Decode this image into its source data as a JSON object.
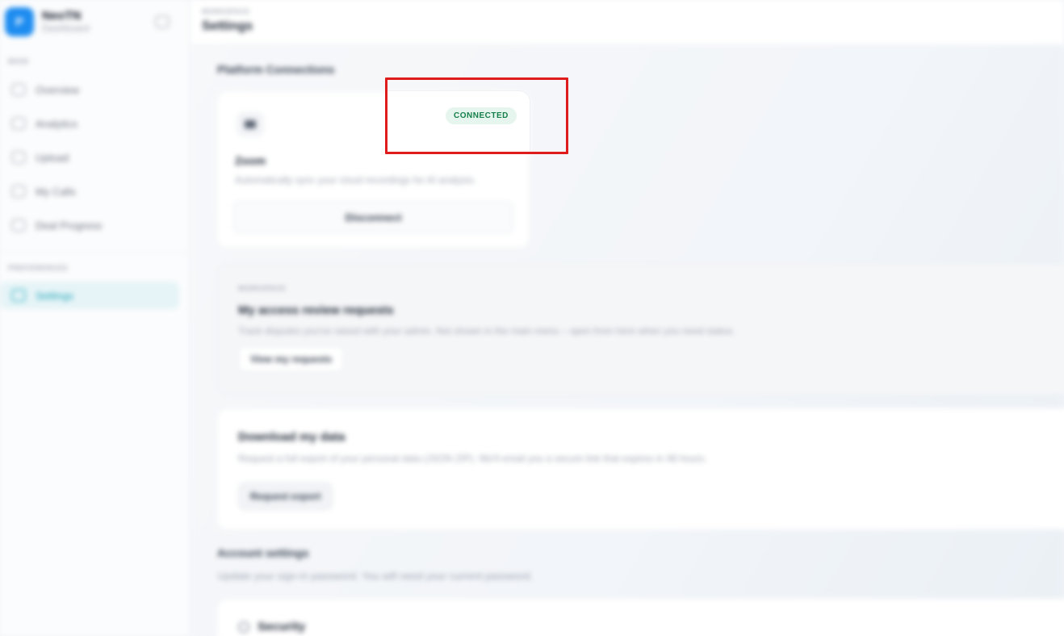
{
  "sidebar": {
    "brand_name": "NeoTN",
    "brand_sub": "Dashboard",
    "brand_initial": "P",
    "section_main": "MAIN",
    "section_prefs": "PREFERENCES",
    "items": [
      {
        "label": "Overview",
        "icon": "grid-icon"
      },
      {
        "label": "Analytics",
        "icon": "chart-icon"
      },
      {
        "label": "Upload",
        "icon": "upload-icon"
      },
      {
        "label": "My Calls",
        "icon": "phone-icon"
      },
      {
        "label": "Deal Progress",
        "icon": "trend-icon"
      },
      {
        "label": "Settings",
        "icon": "gear-icon",
        "active": true
      }
    ]
  },
  "header": {
    "eyebrow": "WORKSPACE",
    "title": "Settings"
  },
  "platform": {
    "title": "Platform Connections",
    "zoom": {
      "name": "Zoom",
      "description": "Automatically sync your cloud recordings for AI analysis.",
      "status": "CONNECTED",
      "button": "Disconnect"
    }
  },
  "access": {
    "eyebrow": "WORKSPACE",
    "title": "My access review requests",
    "description": "Track disputes you've raised with your admin. Not shown in the main menu – open from here when you need status.",
    "button": "View my requests"
  },
  "download": {
    "title": "Download my data",
    "description": "Request a full export of your personal data (JSON ZIP). We'll email you a secure link that expires in 48 hours.",
    "button": "Request export"
  },
  "account": {
    "title": "Account settings",
    "description": "Update your sign-in password. You will need your current password.",
    "security_title": "Security"
  },
  "colors": {
    "accent": "#1fa3b8",
    "brand": "#1d8cf0",
    "connected_bg": "#e6f6ee",
    "connected_text": "#157f4a",
    "highlight": "#e01b1b"
  }
}
